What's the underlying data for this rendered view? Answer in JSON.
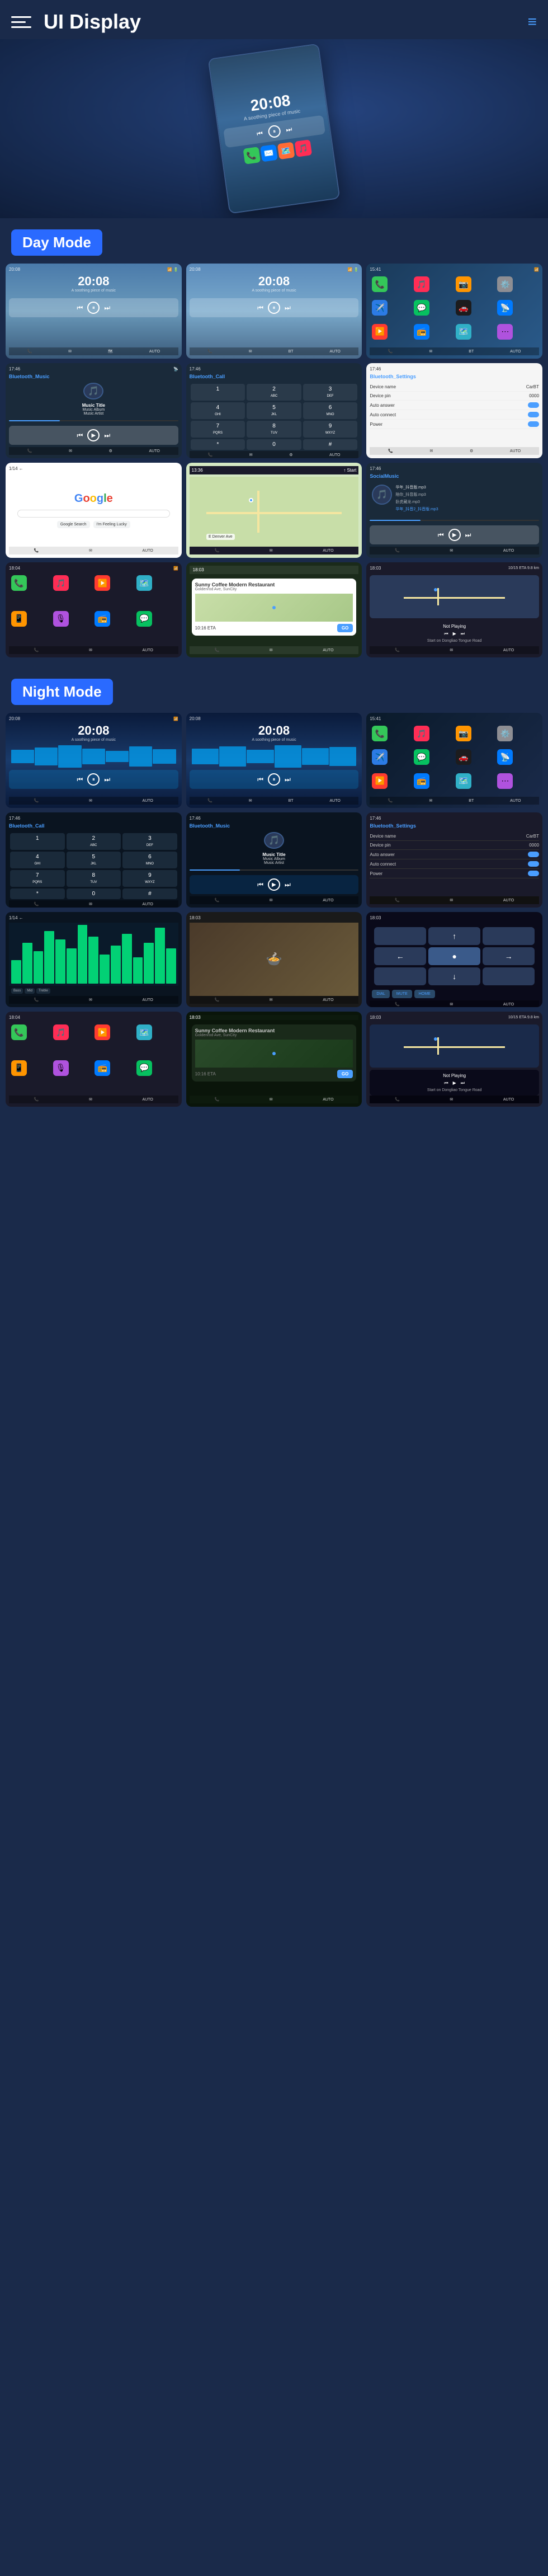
{
  "header": {
    "title": "UI Display",
    "menu_icon": "☰",
    "nav_icon": "≡"
  },
  "day_mode": {
    "label": "Day Mode"
  },
  "night_mode": {
    "label": "Night Mode"
  },
  "screens": {
    "music_time": "20:08",
    "music_subtitle": "A soothing piece of music",
    "bt_music_title": "Bluetooth_Music",
    "bt_call_title": "Bluetooth_Call",
    "bt_settings_title": "Bluetooth_Settings",
    "song_title": "Music Title",
    "song_album": "Music Album",
    "song_artist": "Music Artist",
    "device_name_label": "Device name",
    "device_name_val": "CarBT",
    "device_pin_label": "Device pin",
    "device_pin_val": "0000",
    "auto_answer_label": "Auto answer",
    "auto_connect_label": "Auto connect",
    "power_label": "Power",
    "google_text": "Google",
    "coffee_shop": "Sunny Coffee Modern Restaurant",
    "coffee_addr": "Goldenrod Ave, SunCity",
    "eta_label": "10:16 ETA",
    "dist_label": "10/15 ETA  9.8 km",
    "go_label": "GO",
    "not_playing_label": "Not Playing",
    "start_label": "Start on Dongliao Tongue Road",
    "social_music_title": "SocialMusic",
    "dialpad": [
      "1",
      "2",
      "3",
      "4",
      "5",
      "6",
      "7",
      "8",
      "9",
      "*",
      "0",
      "#"
    ],
    "dial_labels": [
      "",
      "ABC",
      "DEF",
      "GHI",
      "JKL",
      "MNO",
      "PQRS",
      "TUV",
      "WXYZ",
      "",
      "",
      ""
    ]
  }
}
